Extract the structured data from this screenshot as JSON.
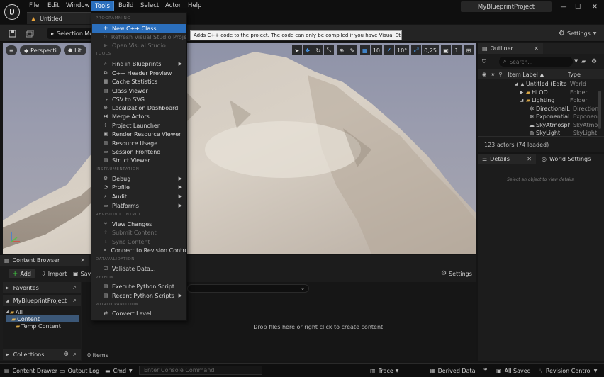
{
  "menubar": {
    "items": [
      "File",
      "Edit",
      "Window",
      "Tools",
      "Build",
      "Select",
      "Actor",
      "Help"
    ],
    "project_name": "MyBlueprintProject",
    "doc_tab": "Untitled"
  },
  "toolbar": {
    "selection_mode": "Selection Mo",
    "settings": "Settings"
  },
  "viewport": {
    "perspective": "Perspective",
    "lit": "Lit",
    "grid_snap": "10",
    "rot_snap": "10°",
    "scale_snap": "0,25",
    "camera_speed": "1"
  },
  "tools_menu": {
    "sections": {
      "programming": "PROGRAMMING",
      "tools": "TOOLS",
      "instrumentation": "INSTRUMENTATION",
      "revision_control": "REVISION CONTROL",
      "datavalidation": "DATAVALIDATION",
      "python": "PYTHON",
      "world_partition": "WORLD PARTITION"
    },
    "items": {
      "new_cpp_class": "New C++ Class...",
      "refresh_vs": "Refresh Visual Studio Project",
      "open_vs": "Open Visual Studio",
      "find_in_blueprints": "Find in Blueprints",
      "cpp_header_preview": "C++ Header Preview",
      "cache_statistics": "Cache Statistics",
      "class_viewer": "Class Viewer",
      "csv_to_svg": "CSV to SVG",
      "localization_dashboard": "Localization Dashboard",
      "merge_actors": "Merge Actors",
      "project_launcher": "Project Launcher",
      "render_resource_viewer": "Render Resource Viewer",
      "resource_usage": "Resource Usage",
      "session_frontend": "Session Frontend",
      "struct_viewer": "Struct Viewer",
      "debug": "Debug",
      "profile": "Profile",
      "audit": "Audit",
      "platforms": "Platforms",
      "view_changes": "View Changes",
      "submit_content": "Submit Content",
      "sync_content": "Sync Content",
      "connect_rc": "Connect to Revision Control...",
      "validate_data": "Validate Data...",
      "execute_python": "Execute Python Script...",
      "recent_python": "Recent Python Scripts",
      "convert_level": "Convert Level..."
    },
    "tooltip": "Adds C++ code to the project. The code can only be compiled if you have Visual Studio installed."
  },
  "outliner": {
    "tab": "Outliner",
    "search_placeholder": "Search...",
    "col_label": "Item Label ▲",
    "col_type": "Type",
    "rows": [
      {
        "label": "Untitled (Editor)",
        "type": "World"
      },
      {
        "label": "HLOD",
        "type": "Folder"
      },
      {
        "label": "Lighting",
        "type": "Folder"
      },
      {
        "label": "DirectionalLig",
        "type": "Direction"
      },
      {
        "label": "ExponentialHe",
        "type": "Exponent"
      },
      {
        "label": "SkyAtmosphe",
        "type": "SkyAtmo"
      },
      {
        "label": "SkyLight",
        "type": "SkyLight"
      }
    ],
    "count": "123 actors (74 loaded)"
  },
  "details": {
    "tab": "Details",
    "world_settings_tab": "World Settings",
    "empty_msg": "Select an object to view details."
  },
  "content_browser": {
    "tab": "Content Browser",
    "add": "Add",
    "import": "Import",
    "save_all": "Sav",
    "settings": "Settings",
    "favorites": "Favorites",
    "project": "MyBlueprintProject",
    "tree": [
      "All",
      "Content",
      "Temp Content"
    ],
    "collections": "Collections",
    "drop_msg": "Drop files here or right click to create content.",
    "items_count": "0 items"
  },
  "statusbar": {
    "content_drawer": "Content Drawer",
    "output_log": "Output Log",
    "cmd": "Cmd",
    "console_placeholder": "Enter Console Command",
    "trace": "Trace",
    "derived_data": "Derived Data",
    "all_saved": "All Saved",
    "revision_control": "Revision Control"
  }
}
